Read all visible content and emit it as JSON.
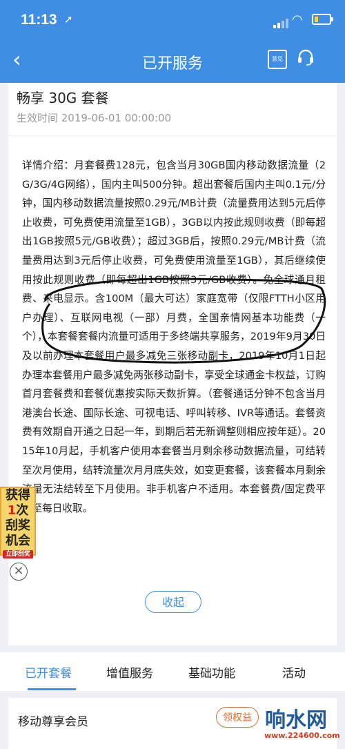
{
  "status_bar": {
    "time": "11:13",
    "location_icon": "location-arrow-icon",
    "signal_icon": "cellular-signal-icon",
    "wifi_icon": "wifi-icon",
    "battery_icon": "battery-icon"
  },
  "nav": {
    "title": "已开服务",
    "back_icon": "chevron-left-icon",
    "feedback_icon": "feedback-icon",
    "feedback_label": "意见",
    "support_icon": "headset-icon"
  },
  "package": {
    "name": "畅享 30G 套餐",
    "effective_time": "生效时间 2019-06-01 00:00:00",
    "description": "详情介绍：月套餐费128元，包含当月30GB国内移动数据流量（2G/3G/4G网络），国内主叫500分钟。超出套餐后国内主叫0.1元/分钟，国内移动数据流量按照0.29元/MB计费（流量费用达到5元后停止收费，可免费使用流量至1GB），3GB以内按此规则收费（即每超出1GB按照5元/GB收费）；超过3GB后，按照0.29元/MB计费（流量费用达到3元后停止收费，可免费使用流量至1GB），其后继续使用按此规则收费（即每超出1GB按照3元/GB收费）。免全球通月租费、来电显示。含100M（最大可达）家庭宽带（仅限FTTH小区用户办理）、互联网电视（一部）月费，全国亲情网基本功能费（一个），本套餐套餐内流量可适用于多终端共享服务，2019年9月30日及以前办理本套餐用户最多减免三张移动副卡，2019年10月1日起办理本套餐用户最多减免两张移动副卡，享受全球通金卡权益，订购首月套餐费和套餐优惠按实际天数折算。（套餐通话分钟不包含当月港澳台长途、国际长途、可视电话、呼叫转移、IVR等通话。套餐资费有效期自开通之日起一年，到期后若无新调整则相应按年延）。2015年10月起，手机客户使用本套餐当月剩余移动数据流量，可结转至次月使用，结转流量次月月底失效，如变更套餐，该套餐本月剩余流量无法结转至下月使用。非手机客户不适用。本套餐费/固定费平摊至每日收取。",
    "collapse_label": "收起"
  },
  "tabs": [
    {
      "label": "已开套餐",
      "active": true
    },
    {
      "label": "增值服务",
      "active": false
    },
    {
      "label": "基础功能",
      "active": false
    },
    {
      "label": "活动",
      "active": false
    }
  ],
  "member": {
    "title": "移动尊享会员",
    "claim_label": "领权益"
  },
  "promo": {
    "line1": "获得",
    "big": "1",
    "line1b": "次",
    "line2": "刮奖",
    "line3": "机会",
    "tag": "立即刮奖",
    "close_icon": "close-circle-icon"
  },
  "watermark": {
    "text": "响水网",
    "url": "www.224600.com"
  },
  "colors": {
    "brand": "#3e8ee6",
    "accent_orange": "#e06a2b",
    "page_bg": "#eef0f5"
  }
}
